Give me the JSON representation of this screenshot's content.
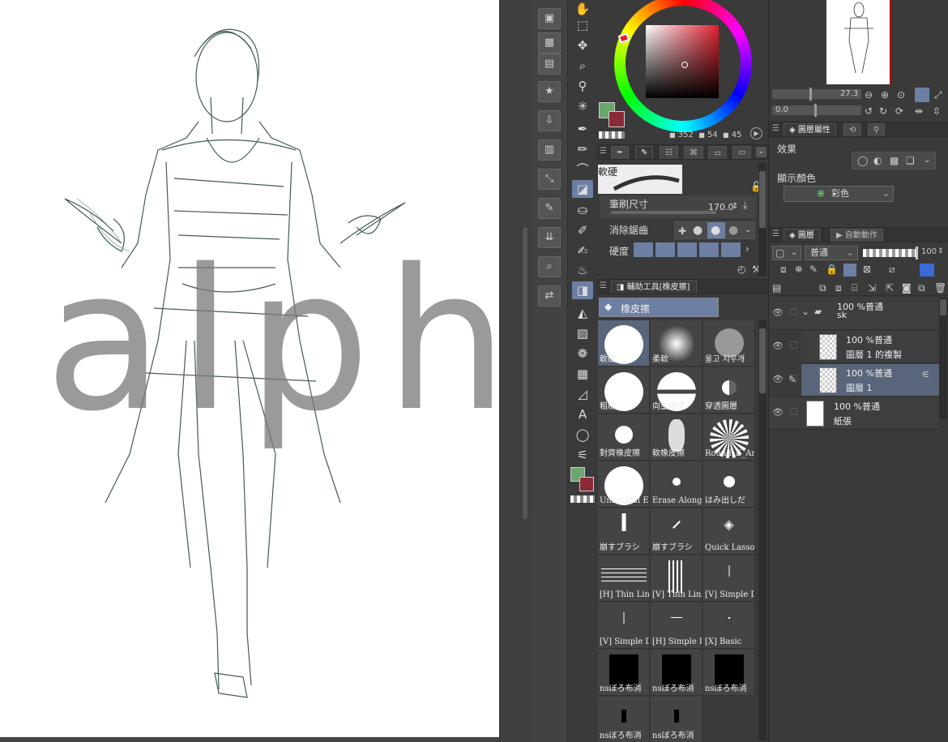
{
  "colors": {
    "main": "#6aa76f",
    "sub": "#8a2a36",
    "accent": "#6d7fa3",
    "panel_bg": "#3a3a3a"
  },
  "color_panel": {
    "values": {
      "h": "352",
      "s": "54",
      "v": "45"
    }
  },
  "tool_property": {
    "tab_icons": [
      "pen-icon",
      "brush-icon",
      "eraser-icon",
      "fill-icon",
      "shape-icon"
    ],
    "hardness_label": "軟硬",
    "brush_size_label": "筆刷尺寸",
    "brush_size_value": "170.0",
    "antialias_label": "消除鋸齒",
    "hardness2_label": "硬度"
  },
  "subtool": {
    "tab_label": "輔助工具[橡皮擦]",
    "group_label": "橡皮擦",
    "brushes": [
      {
        "name": "軟硬",
        "preview": "big-circle",
        "selected": true
      },
      {
        "name": "柔軟",
        "preview": "soft-circle",
        "selected": false
      },
      {
        "name": "울고 지우개",
        "preview": "gray-circle",
        "selected": false
      },
      {
        "name": "粗糙",
        "preview": "big-circle",
        "selected": false
      },
      {
        "name": "向量線用",
        "preview": "split-circle",
        "selected": false
      },
      {
        "name": "穿透圖層",
        "preview": "half-circle",
        "selected": false
      },
      {
        "name": "對齊橡皮擦",
        "preview": "mid-circle",
        "selected": false
      },
      {
        "name": "軟橡皮擦",
        "preview": "rough-blob",
        "selected": false
      },
      {
        "name": "Round_E_Ar",
        "preview": "noise-circle",
        "selected": false
      },
      {
        "name": "Unhelpful Er",
        "preview": "big-circle",
        "selected": false
      },
      {
        "name": "Erase Along E",
        "preview": "dot",
        "selected": false
      },
      {
        "name": "はみ出しだ",
        "preview": "small-circle",
        "selected": false
      },
      {
        "name": "崩すブラシ",
        "preview": "bar",
        "selected": false
      },
      {
        "name": "崩すブラシ",
        "preview": "slash",
        "selected": false
      },
      {
        "name": "Quick Lasso E",
        "preview": "eraser",
        "selected": false
      },
      {
        "name": "[H] Thin Lin",
        "preview": "hlines",
        "selected": false
      },
      {
        "name": "[V] Thin Line",
        "preview": "vlines",
        "selected": false
      },
      {
        "name": "[V] Simple D",
        "preview": "vline",
        "selected": false
      },
      {
        "name": "[V] Simple D",
        "preview": "vline",
        "selected": false
      },
      {
        "name": "[H] Simple D",
        "preview": "hline",
        "selected": false
      },
      {
        "name": "[X] Basic",
        "preview": "tiny-dot",
        "selected": false
      },
      {
        "name": "nsぼろ布消",
        "preview": "black-block",
        "selected": false
      },
      {
        "name": "nsぼろ布消",
        "preview": "black-block",
        "selected": false
      },
      {
        "name": "nsぼろ布消",
        "preview": "black-block",
        "selected": false
      },
      {
        "name": "nsぼろ布消",
        "preview": "speck",
        "selected": false
      },
      {
        "name": "nsぼろ布消",
        "preview": "speck",
        "selected": false
      }
    ]
  },
  "navigator": {
    "zoom": "27.3",
    "rotation": "0.0"
  },
  "layer_property": {
    "tab_label": "圖層屬性",
    "effect_label": "效果",
    "display_color_label": "顯示顏色",
    "display_color_value": "彩色"
  },
  "layers_panel": {
    "tab_label": "圖層",
    "tab2_label": "自動動作",
    "blend_mode": "普通",
    "opacity": "100",
    "layers": [
      {
        "line1": "100 %普通",
        "line2": "sk",
        "kind": "folder",
        "selected": false
      },
      {
        "line1": "100 %普通",
        "line2": "圖層 1 的複製",
        "kind": "raster",
        "selected": false
      },
      {
        "line1": "100 %普通",
        "line2": "圖層 1",
        "kind": "raster",
        "selected": true
      },
      {
        "line1": "100 %普通",
        "line2": "紙張",
        "kind": "paper",
        "selected": false
      }
    ]
  },
  "canvas": {
    "watermark": "alphalyr"
  }
}
